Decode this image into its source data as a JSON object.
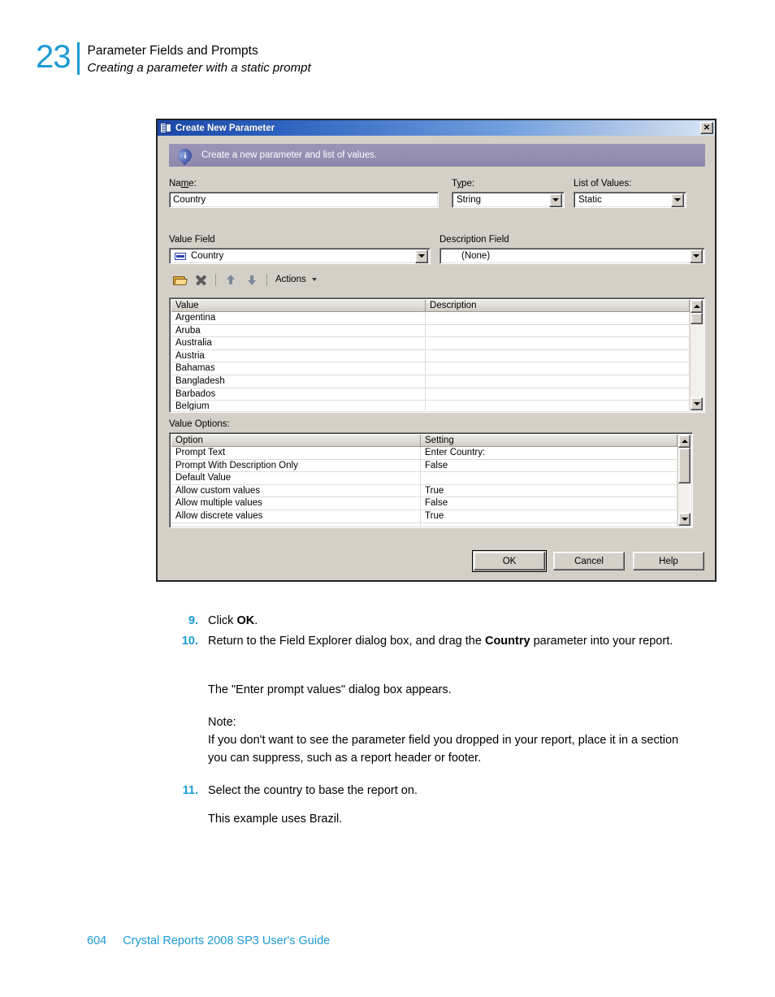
{
  "page": {
    "chapter_number": "23",
    "chapter_title": "Parameter Fields and Prompts",
    "chapter_subtitle": "Creating a parameter with a static prompt",
    "footer_page_number": "604",
    "footer_book_title": "Crystal Reports 2008 SP3 User's Guide",
    "accent_color": "#1c9ad6"
  },
  "dialog": {
    "title": "Create New Parameter",
    "close_label": "✕",
    "banner_text": "Create a new parameter and list of values.",
    "banner_icon_glyph": "i",
    "fields": {
      "name_label_pre": "Na",
      "name_label_acc": "m",
      "name_label_post": "e:",
      "name_value": "Country",
      "type_label_pre": "T",
      "type_label_acc": "y",
      "type_label_post": "pe:",
      "type_value": "String",
      "list_of_values_label": "List of Values:",
      "list_of_values_value": "Static",
      "value_field_label": "Value Field",
      "value_field_value": "Country",
      "description_field_label": "Description Field",
      "description_field_value": "(None)"
    },
    "toolbar": {
      "open_title": "Open",
      "delete_title": "Delete",
      "move_up_title": "Move Up",
      "move_down_title": "Move Down",
      "actions_label": "Actions"
    },
    "values_grid": {
      "columns": [
        "Value",
        "Description"
      ],
      "rows": [
        [
          "Argentina",
          ""
        ],
        [
          "Aruba",
          ""
        ],
        [
          "Australia",
          ""
        ],
        [
          "Austria",
          ""
        ],
        [
          "Bahamas",
          ""
        ],
        [
          "Bangladesh",
          ""
        ],
        [
          "Barbados",
          ""
        ],
        [
          "Belgium",
          ""
        ]
      ]
    },
    "value_options": {
      "label": "Value Options:",
      "columns": [
        "Option",
        "Setting"
      ],
      "rows": [
        [
          "Prompt Text",
          "Enter Country:"
        ],
        [
          "Prompt With Description Only",
          "False"
        ],
        [
          "Default Value",
          ""
        ],
        [
          "Allow custom values",
          "True"
        ],
        [
          "Allow multiple values",
          "False"
        ],
        [
          "Allow discrete values",
          "True"
        ],
        [
          "",
          ""
        ]
      ]
    },
    "buttons": {
      "ok": "OK",
      "cancel": "Cancel",
      "help": "Help"
    }
  },
  "content": {
    "step9_num": "9.",
    "step9_text_a": "Click ",
    "step9_bold": "OK",
    "step9_text_b": ".",
    "step10_num": "10.",
    "step10_text_a": "Return to the Field Explorer dialog box, and drag the ",
    "step10_bold": "Country",
    "step10_text_b": " parameter into your report.",
    "para1": "The \"Enter prompt values\" dialog box appears.",
    "note_label": "Note:",
    "note_text": "If you don't want to see the parameter field you dropped in your report, place it in a section you can suppress, such as a report header or footer.",
    "step11_num": "11.",
    "step11_text": "Select the country to base the report on.",
    "para2": "This example uses Brazil."
  }
}
